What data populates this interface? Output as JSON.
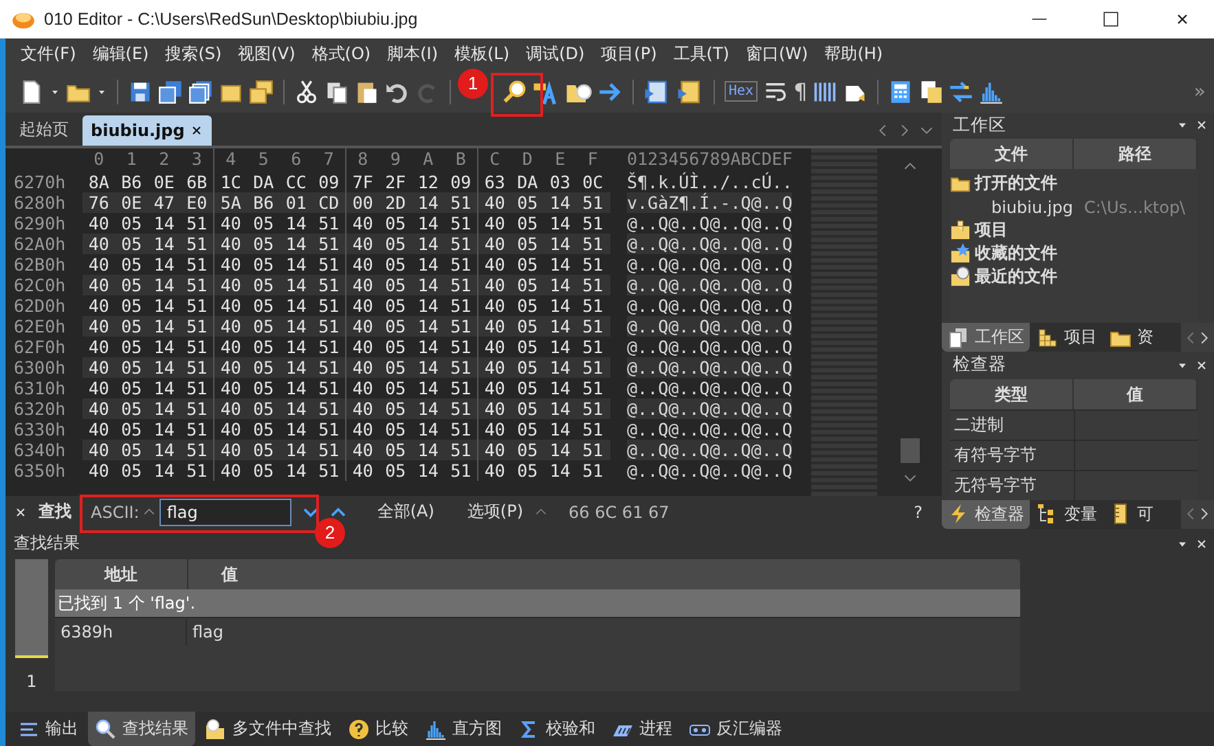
{
  "window": {
    "title": "010 Editor - C:\\Users\\RedSun\\Desktop\\biubiu.jpg"
  },
  "menu": [
    "文件(F)",
    "编辑(E)",
    "搜索(S)",
    "视图(V)",
    "格式(O)",
    "脚本(I)",
    "模板(L)",
    "调试(D)",
    "项目(P)",
    "工具(T)",
    "窗口(W)",
    "帮助(H)"
  ],
  "toolbar": {
    "hex_label": "Hex",
    "pilcrow": "¶",
    "overflow": "»"
  },
  "annotations": [
    {
      "label": "1"
    },
    {
      "label": "2"
    }
  ],
  "doc_tabs": [
    {
      "label": "起始页",
      "selected": false,
      "closable": false
    },
    {
      "label": "biubiu.jpg",
      "selected": true,
      "closable": true
    }
  ],
  "hex_view": {
    "columns": [
      "0",
      "1",
      "2",
      "3",
      "4",
      "5",
      "6",
      "7",
      "8",
      "9",
      "A",
      "B",
      "C",
      "D",
      "E",
      "F"
    ],
    "ascii_header": "0123456789ABCDEF",
    "rows": [
      {
        "address": "6270h",
        "bytes": "8A B6 0E 6B 1C DA CC 09 7F 2F 12 09 63 DA 03 0C",
        "ascii": "Š¶.k.ÚÌ../..cÚ.."
      },
      {
        "address": "6280h",
        "bytes": "76 0E 47 E0 5A B6 01 CD 00 2D 14 51 40 05 14 51",
        "ascii": "v.GàZ¶.Í.-.Q@..Q"
      },
      {
        "address": "6290h",
        "bytes": "40 05 14 51 40 05 14 51 40 05 14 51 40 05 14 51",
        "ascii": "@..Q@..Q@..Q@..Q"
      },
      {
        "address": "62A0h",
        "bytes": "40 05 14 51 40 05 14 51 40 05 14 51 40 05 14 51",
        "ascii": "@..Q@..Q@..Q@..Q"
      },
      {
        "address": "62B0h",
        "bytes": "40 05 14 51 40 05 14 51 40 05 14 51 40 05 14 51",
        "ascii": "@..Q@..Q@..Q@..Q"
      },
      {
        "address": "62C0h",
        "bytes": "40 05 14 51 40 05 14 51 40 05 14 51 40 05 14 51",
        "ascii": "@..Q@..Q@..Q@..Q"
      },
      {
        "address": "62D0h",
        "bytes": "40 05 14 51 40 05 14 51 40 05 14 51 40 05 14 51",
        "ascii": "@..Q@..Q@..Q@..Q"
      },
      {
        "address": "62E0h",
        "bytes": "40 05 14 51 40 05 14 51 40 05 14 51 40 05 14 51",
        "ascii": "@..Q@..Q@..Q@..Q"
      },
      {
        "address": "62F0h",
        "bytes": "40 05 14 51 40 05 14 51 40 05 14 51 40 05 14 51",
        "ascii": "@..Q@..Q@..Q@..Q"
      },
      {
        "address": "6300h",
        "bytes": "40 05 14 51 40 05 14 51 40 05 14 51 40 05 14 51",
        "ascii": "@..Q@..Q@..Q@..Q"
      },
      {
        "address": "6310h",
        "bytes": "40 05 14 51 40 05 14 51 40 05 14 51 40 05 14 51",
        "ascii": "@..Q@..Q@..Q@..Q"
      },
      {
        "address": "6320h",
        "bytes": "40 05 14 51 40 05 14 51 40 05 14 51 40 05 14 51",
        "ascii": "@..Q@..Q@..Q@..Q"
      },
      {
        "address": "6330h",
        "bytes": "40 05 14 51 40 05 14 51 40 05 14 51 40 05 14 51",
        "ascii": "@..Q@..Q@..Q@..Q"
      },
      {
        "address": "6340h",
        "bytes": "40 05 14 51 40 05 14 51 40 05 14 51 40 05 14 51",
        "ascii": "@..Q@..Q@..Q@..Q"
      },
      {
        "address": "6350h",
        "bytes": "40 05 14 51 40 05 14 51 40 05 14 51 40 05 14 51",
        "ascii": "@..Q@..Q@..Q@..Q"
      }
    ]
  },
  "workspace_panel": {
    "title": "工作区",
    "columns": [
      "文件",
      "路径"
    ],
    "tree": [
      {
        "label": "打开的文件",
        "kind": "open",
        "children": [
          {
            "label": "biubiu.jpg",
            "path": "C:\\Us...ktop\\"
          }
        ]
      },
      {
        "label": "项目",
        "kind": "project"
      },
      {
        "label": "收藏的文件",
        "kind": "favorite"
      },
      {
        "label": "最近的文件",
        "kind": "recent"
      }
    ],
    "tabs": [
      {
        "label": "工作区",
        "kind": "workspace",
        "selected": true
      },
      {
        "label": "项目",
        "kind": "project",
        "selected": false
      },
      {
        "label": "资",
        "kind": "folder",
        "selected": false
      }
    ]
  },
  "inspector_panel": {
    "title": "检查器",
    "columns": [
      "类型",
      "值"
    ],
    "rows": [
      "二进制",
      "有符号字节",
      "无符号字节"
    ],
    "tabs": [
      {
        "label": "检查器",
        "kind": "bolt",
        "selected": true
      },
      {
        "label": "变量",
        "kind": "vars",
        "selected": false
      },
      {
        "label": "可",
        "kind": "ruler",
        "selected": false
      }
    ]
  },
  "find_bar": {
    "title": "查找",
    "mode": "ASCII:",
    "value": "flag",
    "all": "全部(A)",
    "options": "选项(P)",
    "hex": "66 6C 61 67",
    "help": "?"
  },
  "find_results": {
    "title": "查找结果",
    "columns": [
      "地址",
      "值"
    ],
    "summary": "已找到 1 个 'flag'.",
    "rows": [
      {
        "address": "6389h",
        "value": "flag"
      }
    ],
    "count": "1"
  },
  "bottom_tabs": [
    {
      "label": "输出",
      "kind": "output",
      "selected": false
    },
    {
      "label": "查找结果",
      "kind": "find",
      "selected": true
    },
    {
      "label": "多文件中查找",
      "kind": "multi",
      "selected": false
    },
    {
      "label": "比较",
      "kind": "compare",
      "selected": false
    },
    {
      "label": "直方图",
      "kind": "histogram",
      "selected": false
    },
    {
      "label": "校验和",
      "kind": "checksum",
      "selected": false
    },
    {
      "label": "进程",
      "kind": "process",
      "selected": false
    },
    {
      "label": "反汇编器",
      "kind": "disasm",
      "selected": false
    }
  ]
}
